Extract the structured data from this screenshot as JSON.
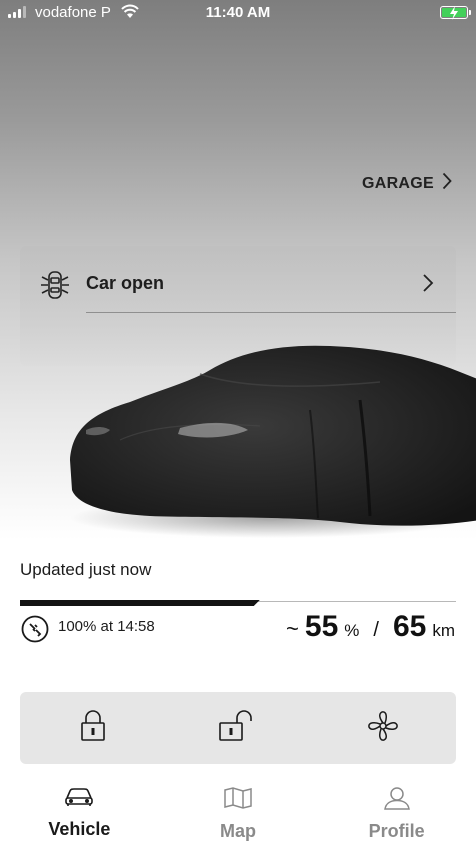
{
  "status_bar": {
    "carrier": "vodafone P",
    "time": "11:40 AM"
  },
  "header": {
    "garage_label": "GARAGE"
  },
  "vehicle_status": {
    "label": "Car open"
  },
  "info": {
    "updated_text": "Updated just now",
    "range_fraction": 0.55,
    "charge_text": "100% at 14:58",
    "range_prefix": "~",
    "charge_percent": "55",
    "percent_unit": "%",
    "separator": "/",
    "range_km": "65",
    "range_unit": "km"
  },
  "actions": {
    "items": [
      {
        "icon": "lock-icon"
      },
      {
        "icon": "unlock-icon"
      },
      {
        "icon": "fan-icon"
      }
    ]
  },
  "tabs": [
    {
      "label": "Vehicle",
      "icon": "car-icon",
      "active": true
    },
    {
      "label": "Map",
      "icon": "map-icon",
      "active": false
    },
    {
      "label": "Profile",
      "icon": "person-icon",
      "active": false
    }
  ],
  "colors": {
    "accent": "#2d7fd3",
    "battery_fill": "#43d05a"
  }
}
